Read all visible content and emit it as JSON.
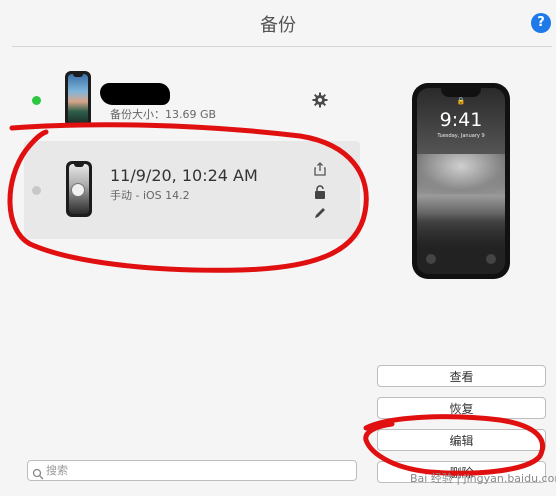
{
  "header": {
    "title": "备份",
    "help_label": "?"
  },
  "device": {
    "size_label": "备份大小：13.69 GB",
    "status_color": "#28c840",
    "settings_icon": "gear-icon"
  },
  "backups": [
    {
      "date": "11/9/20, 10:24 AM",
      "detail": "手动 - iOS 14.2",
      "status_color": "#c8c8c8",
      "actions": [
        "share-icon",
        "lock-icon",
        "pencil-icon"
      ]
    }
  ],
  "preview": {
    "time": "9:41",
    "date": "Tuesday, January 9"
  },
  "buttons": {
    "view": "查看",
    "restore": "恢复",
    "edit": "编辑",
    "delete": "删除"
  },
  "search": {
    "placeholder": "搜索",
    "value": ""
  },
  "watermark": "Bai 经验 | jingyan.baidu.com",
  "colors": {
    "accent": "#1e7ae8",
    "annotation": "#e01010"
  }
}
